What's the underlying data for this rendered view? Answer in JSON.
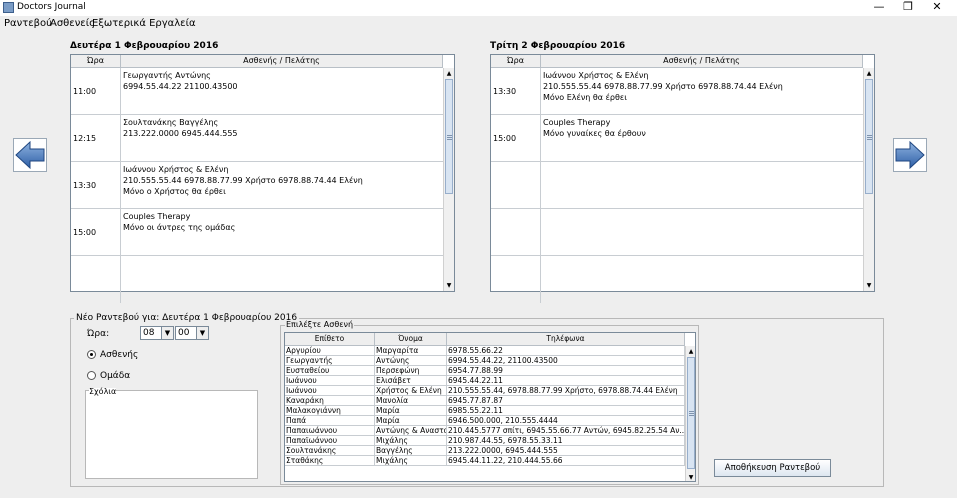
{
  "window": {
    "title": "Doctors Journal",
    "minimize": "—",
    "maximize": "❐",
    "close": "✕"
  },
  "menu": [
    "Ραντεβού",
    "Ασθενείς",
    "Εξωτερικά Εργαλεία"
  ],
  "day1": {
    "title": "Δευτέρα 1 Φεβρουαρίου 2016",
    "col_time": "Ώρα",
    "col_patient": "Ασθενής / Πελάτης",
    "rows": [
      {
        "time": "11:00",
        "lines": [
          "Γεωργαντής  Αντώνης",
          "6994.55.44.22  21100.43500"
        ]
      },
      {
        "time": "12:15",
        "lines": [
          "Σουλτανάκης  Βαγγέλης",
          "213.222.0000  6945.444.555"
        ]
      },
      {
        "time": "13:30",
        "lines": [
          "Ιωάννου  Χρήστος & Ελένη",
          "210.555.55.44  6978.88.77.99 Χρήστο  6978.88.74.44 Ελένη",
          "Μόνο ο Χρήστος θα έρθει"
        ]
      },
      {
        "time": "15:00",
        "lines": [
          "Couples Therapy",
          "Μόνο οι άντρες της ομάδας"
        ]
      },
      {
        "time": "",
        "lines": []
      }
    ]
  },
  "day2": {
    "title": "Τρίτη 2 Φεβρουαρίου 2016",
    "col_time": "Ώρα",
    "col_patient": "Ασθενής / Πελάτης",
    "rows": [
      {
        "time": "13:30",
        "lines": [
          "Ιωάννου Χρήστος & Ελένη",
          "210.555.55.44  6978.88.77.99 Χρήστο  6978.88.74.44 Ελένη",
          "Μόνο Ελένη θα έρθει"
        ]
      },
      {
        "time": "15:00",
        "lines": [
          "Couples Therapy",
          "Μόνο γυναίκες θα έρθουν"
        ]
      },
      {
        "time": "",
        "lines": []
      },
      {
        "time": "",
        "lines": []
      },
      {
        "time": "",
        "lines": []
      }
    ]
  },
  "new_appointment": {
    "legend": "Νέο Ραντεβού για:  Δευτέρα 1 Φεβρουαρίου 2016",
    "hour_label": "Ώρα:",
    "hour_value": "08",
    "minute_value": "00",
    "radio_patient": "Ασθενής",
    "radio_group": "Ομάδα",
    "notes_label": "Σχόλια",
    "save_button": "Αποθήκευση Ραντεβού"
  },
  "patient_picker": {
    "legend": "Επιλέξτε Ασθενή",
    "columns": [
      "Επίθετο",
      "Όνομα",
      "Τηλέφωνα"
    ],
    "rows": [
      [
        "Αργυρίου",
        "Μαργαρίτα",
        "6978.55.66.22"
      ],
      [
        "Γεωργαντής",
        "Αντώνης",
        "6994.55.44.22, 21100.43500"
      ],
      [
        "Ευσταθείου",
        "Περσεφώνη",
        "6954.77.88.99"
      ],
      [
        "Ιωάννου",
        "Ελισάβετ",
        "6945.44.22.11"
      ],
      [
        "Ιωάννου",
        "Χρήστος & Ελένη",
        "210.555.55.44, 6978.88.77.99 Χρήστο, 6978.88.74.44 Ελένη"
      ],
      [
        "Καναράκη",
        "Μανολία",
        "6945.77.87.87"
      ],
      [
        "Μαλακογιάννη",
        "Μαρία",
        "6985.55.22.11"
      ],
      [
        "Παπά",
        "Μαρία",
        "6946.500.000, 210.555.4444"
      ],
      [
        "Παπαιωάννου",
        "Αντώνης & Αναστασία",
        "210.445.5777 σπίτι, 6945.55.66.77 Αντών, 6945.82.25.54 Αν..."
      ],
      [
        "Παπαϊωάννου",
        "Μιχάλης",
        "210.987.44.55, 6978.55.33.11"
      ],
      [
        "Σουλτανάκης",
        "Βαγγέλης",
        "213.222.0000, 6945.444.555"
      ],
      [
        "Σταθάκης",
        "Μιχάλης",
        "6945.44.11.22, 210.444.55.66"
      ]
    ]
  }
}
